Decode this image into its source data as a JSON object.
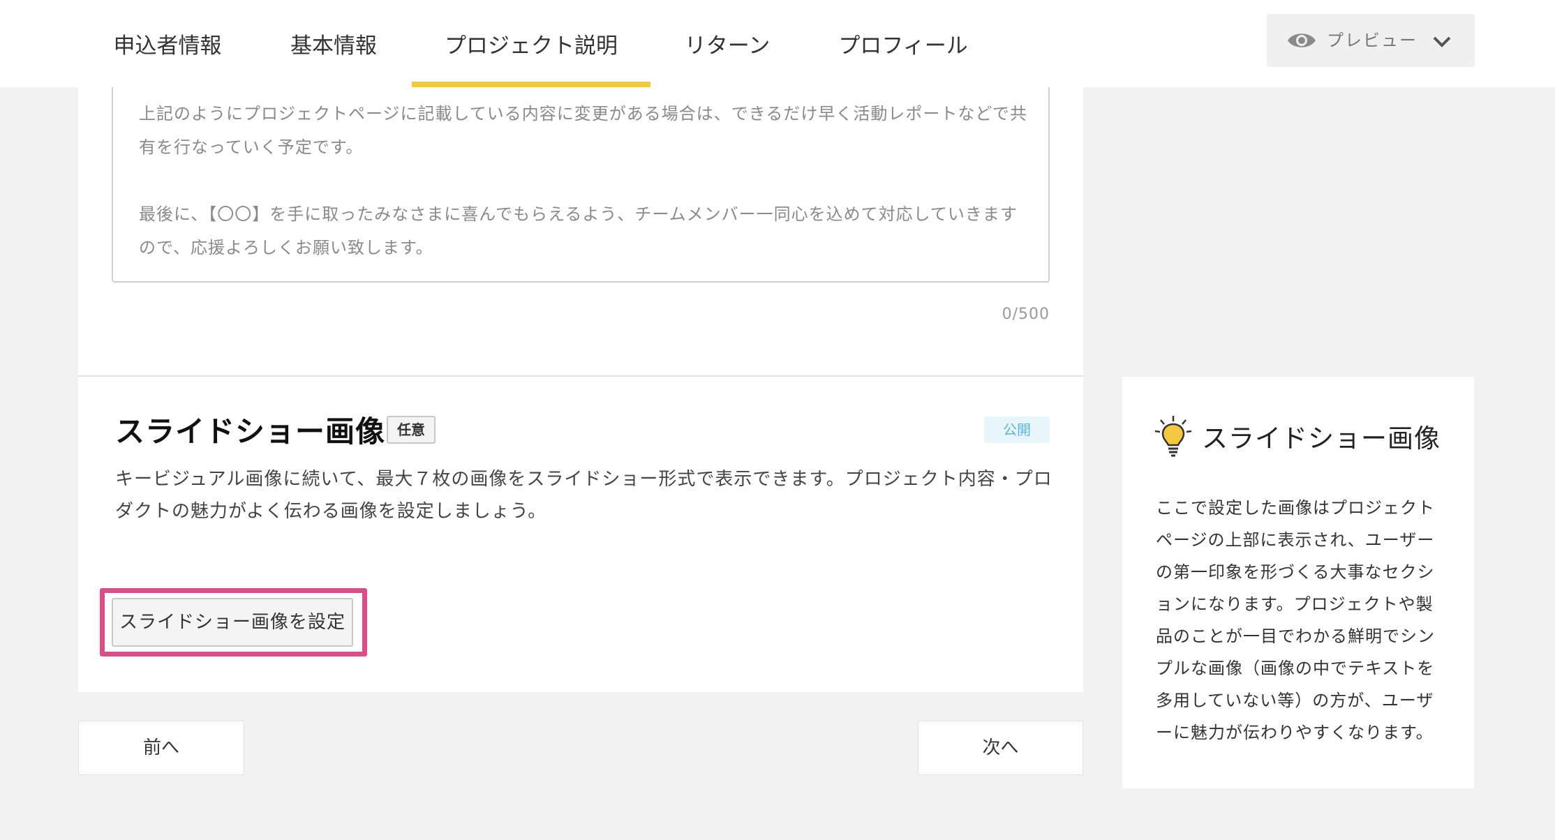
{
  "nav": {
    "tabs": [
      {
        "label": "申込者情報"
      },
      {
        "label": "基本情報"
      },
      {
        "label": "プロジェクト説明"
      },
      {
        "label": "リターン"
      },
      {
        "label": "プロフィール"
      }
    ],
    "active_tab": "プロジェクト説明",
    "preview": {
      "label": "プレビュー",
      "icon": "eye-icon",
      "chevron": "chevron-down-icon"
    }
  },
  "textarea": {
    "paragraph1": "上記のようにプロジェクトページに記載している内容に変更がある場合は、できるだけ早く活動レポートなどで共有を行なっていく予定です。",
    "paragraph2": "最後に、【〇〇】を手に取ったみなさまに喜んでもらえるよう、チームメンバー一同心を込めて対応していきますので、応援よろしくお願い致します。",
    "counter": "0/500"
  },
  "section": {
    "title": "スライドショー画像",
    "optional_badge": "任意",
    "public_badge": "公開",
    "description": "キービジュアル画像に続いて、最大７枚の画像をスライドショー形式で表示できます。プロジェクト内容・プロダクトの魅力がよく伝わる画像を設定しましょう。",
    "set_button": "スライドショー画像を設定"
  },
  "footer_nav": {
    "prev": "前へ",
    "next": "次へ"
  },
  "help": {
    "icon": "lightbulb-icon",
    "title": "スライドショー画像",
    "body": "ここで設定した画像はプロジェクトページの上部に表示され、ユーザーの第一印象を形づくる大事なセクションになります。プロジェクトや製品のことが一目でわかる鮮明でシンプルな画像（画像の中でテキストを多用していない等）の方が、ユーザーに魅力が伝わりやすくなります。"
  },
  "colors": {
    "accent_tab": "#f5c842",
    "highlight": "#d64f86",
    "public_badge_text": "#5bb6db",
    "public_badge_bg": "#e8f5fb"
  }
}
